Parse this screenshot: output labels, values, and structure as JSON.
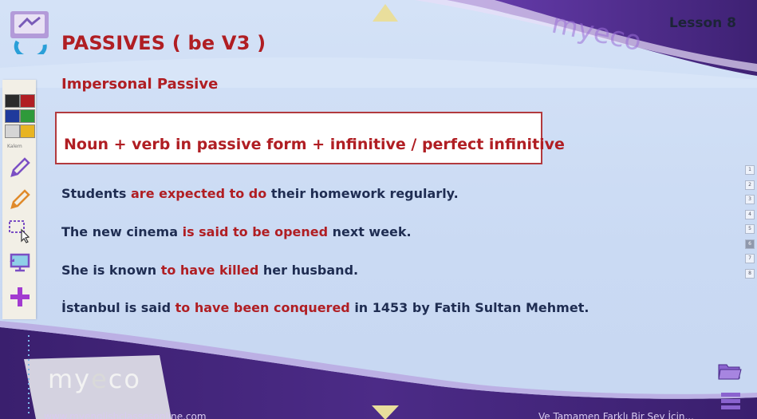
{
  "header": {
    "lesson": "Lesson 8",
    "title": "PASSIVES ( be V3 )",
    "subtitle": "Impersonal Passive"
  },
  "formula": "Noun + verb in passive form + infinitive / perfect infinitive",
  "examples": [
    {
      "before": "Students ",
      "highlight": "are expected to do",
      "after": " their homework regularly."
    },
    {
      "before": "The new cinema ",
      "highlight": "is said to be opened",
      "after": " next week."
    },
    {
      "before": "She is known ",
      "highlight": "to have killed",
      "after": " her husband."
    },
    {
      "before": "İstanbul is said ",
      "highlight": "to have been conquered",
      "after": " in 1453 by Fatih Sultan Mehmet."
    }
  ],
  "toolbar": {
    "colors": [
      "#2b2b2b",
      "#b01e23",
      "#1f3a9c",
      "#2f9a3a",
      "#d5d5d5",
      "#e8b422"
    ],
    "width_label": "Kalem",
    "tools": [
      "pencil-icon",
      "highlighter-icon",
      "selection-icon",
      "screen-icon",
      "add-icon"
    ]
  },
  "pager": {
    "pages": [
      "1",
      "2",
      "3",
      "4",
      "5",
      "6",
      "7",
      "8"
    ],
    "active_index": 5
  },
  "brand": {
    "logo_text_a": "my",
    "logo_text_b": "e",
    "logo_text_c": "co"
  },
  "footer": {
    "left": "www.myenglishclassesonline.com",
    "right": "Ve Tamamen Farklı Bir Şey İçin..."
  },
  "colors": {
    "accent": "#b01e23",
    "text": "#1f2d52",
    "band": "#4b2a85"
  }
}
